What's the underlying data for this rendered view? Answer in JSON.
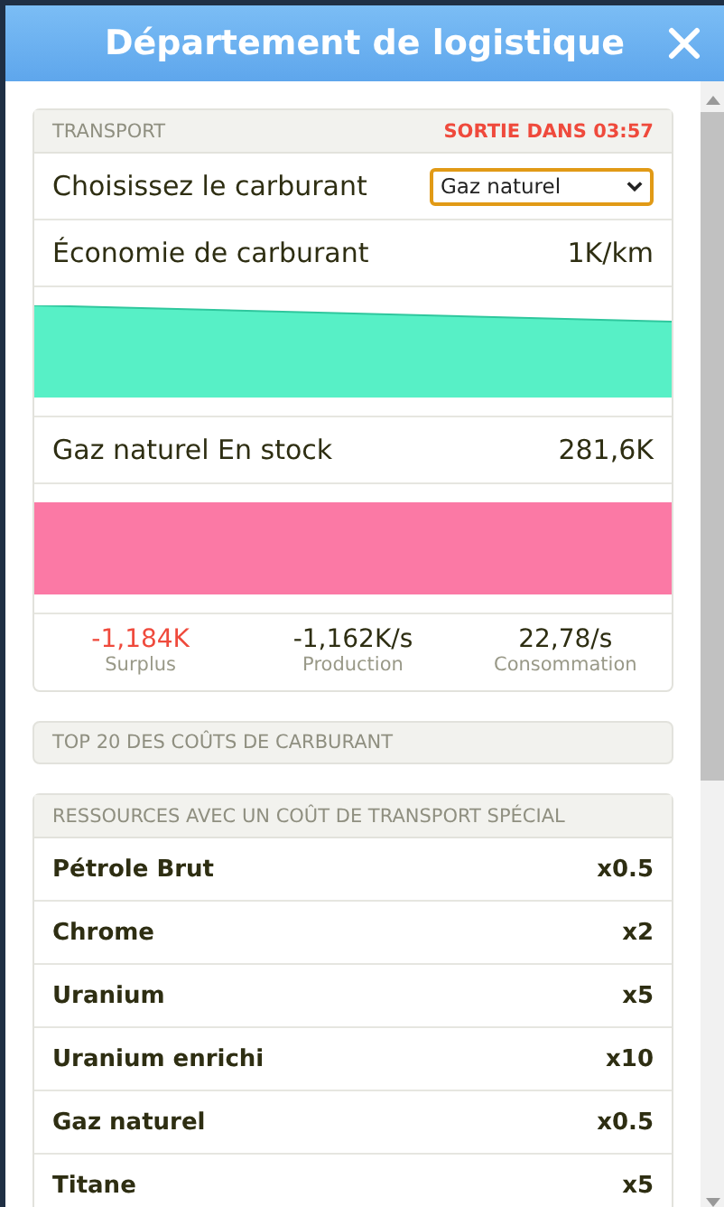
{
  "window": {
    "title": "Département de logistique"
  },
  "transport": {
    "heading": "TRANSPORT",
    "departure": "SORTIE DANS 03:57",
    "fuel_select": {
      "label": "Choisissez le carburant",
      "value": "Gaz naturel"
    },
    "economy": {
      "label": "Économie de carburant",
      "value": "1K/km"
    },
    "stock": {
      "label": "Gaz naturel En stock",
      "value": "281,6K"
    },
    "stats": [
      {
        "value": "-1,184K",
        "label": "Surplus",
        "negative": true
      },
      {
        "value": "-1,162K/s",
        "label": "Production",
        "negative": false
      },
      {
        "value": "22,78/s",
        "label": "Consommation",
        "negative": false
      }
    ]
  },
  "top_costs": {
    "heading": "TOP 20 DES COÛTS DE CARBURANT"
  },
  "special_resources": {
    "heading": "RESSOURCES AVEC UN COÛT DE TRANSPORT SPÉCIAL",
    "rows": [
      {
        "name": "Pétrole Brut",
        "multiplier": "x0.5"
      },
      {
        "name": "Chrome",
        "multiplier": "x2"
      },
      {
        "name": "Uranium",
        "multiplier": "x5"
      },
      {
        "name": "Uranium enrichi",
        "multiplier": "x10"
      },
      {
        "name": "Gaz naturel",
        "multiplier": "x0.5"
      },
      {
        "name": "Titane",
        "multiplier": "x5"
      }
    ]
  }
}
